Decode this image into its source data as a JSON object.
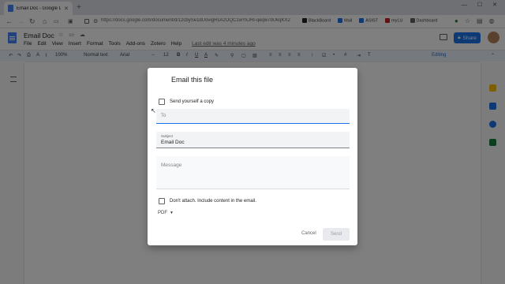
{
  "browser": {
    "tab_title": "Email Doc - Google Docs",
    "new_tab": "+",
    "url": "https://docs.google.com/document/d/1zcbySe1dUovigRsA2OQC1wYkJRl-qeqw7bUkqKX2r...",
    "bookmarks": [
      {
        "label": "BlackBoard",
        "color": "#222222"
      },
      {
        "label": "Mail",
        "color": "#1a73e8"
      },
      {
        "label": "ASIST",
        "color": "#1a73e8"
      },
      {
        "label": "myLU",
        "color": "#c5221f"
      },
      {
        "label": "Dashboard",
        "color": "#5f6368"
      }
    ]
  },
  "doc": {
    "title": "Email Doc",
    "menu": [
      "File",
      "Edit",
      "View",
      "Insert",
      "Format",
      "Tools",
      "Add-ons",
      "Zotero",
      "Help"
    ],
    "last_edit": "Last edit was 4 minutes ago",
    "share_label": "Share",
    "toolbar": {
      "zoom": "100%",
      "style": "Normal text",
      "font": "Arial",
      "size": "12",
      "mode": "Editing"
    }
  },
  "dialog": {
    "title": "Email this file",
    "send_copy_label": "Send yourself a copy",
    "to_placeholder": "To",
    "subject_label": "Subject",
    "subject_value": "Email Doc",
    "message_placeholder": "Message",
    "dont_attach_label": "Don't attach. Include content in the email.",
    "format": "PDF",
    "cancel_label": "Cancel",
    "send_label": "Send"
  },
  "colors": {
    "accent": "#1a73e8",
    "doc_blue": "#4285f4",
    "overlay": "rgba(0,0,0,0.5)"
  }
}
